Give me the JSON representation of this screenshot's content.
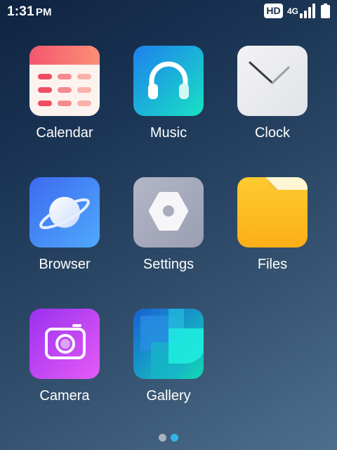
{
  "status_bar": {
    "time": "1:31",
    "ampm": "PM",
    "hd_badge": "HD",
    "network": "4G",
    "signal_icon": "signal-bars-icon",
    "battery_icon": "battery-full-icon"
  },
  "apps": [
    {
      "label": "Calendar",
      "icon": "calendar-icon"
    },
    {
      "label": "Music",
      "icon": "headphones-icon"
    },
    {
      "label": "Clock",
      "icon": "clock-icon"
    },
    {
      "label": "Browser",
      "icon": "planet-icon"
    },
    {
      "label": "Settings",
      "icon": "hexagon-gear-icon"
    },
    {
      "label": "Files",
      "icon": "folder-icon"
    },
    {
      "label": "Camera",
      "icon": "camera-icon"
    },
    {
      "label": "Gallery",
      "icon": "gallery-icon"
    }
  ],
  "page_indicator": {
    "pages": 2,
    "active_page": 2,
    "active_color": "#34b4ec",
    "inactive_color": "#a7b3c1"
  }
}
